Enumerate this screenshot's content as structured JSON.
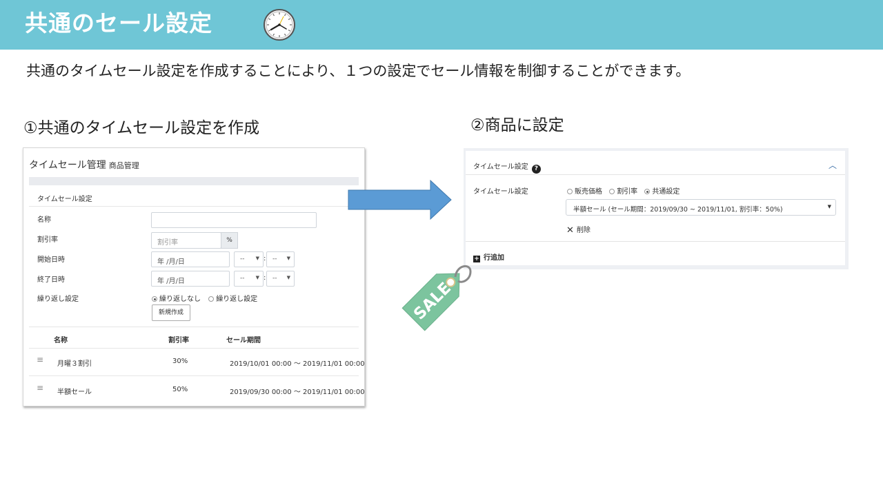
{
  "slide": {
    "title": "共通のセール設定",
    "lead": "共通のタイムセール設定を作成することにより、１つの設定でセール情報を制御することができます。",
    "step1": "①共通のタイムセール設定を作成",
    "step2": "②商品に設定"
  },
  "admin": {
    "title": "タイムセール管理",
    "subtitle": "商品管理",
    "section": "タイムセール設定",
    "name_label": "名称",
    "name_value": "",
    "rate_label": "割引率",
    "rate_placeholder": "割引率",
    "rate_unit": "%",
    "start_label": "開始日時",
    "end_label": "終了日時",
    "date_placeholder": "年 /月/日",
    "time_placeholder": "--",
    "repeat_label": "繰り返し設定",
    "repeat_options": [
      "繰り返しなし",
      "繰り返し設定"
    ],
    "repeat_selected": "繰り返しなし",
    "create_button": "新規作成",
    "columns": [
      "名称",
      "割引率",
      "セール期間"
    ],
    "rows": [
      {
        "name": "月曜３割引",
        "rate": "30%",
        "period": "2019/10/01 00:00 ～ 2019/11/01 00:00"
      },
      {
        "name": "半額セール",
        "rate": "50%",
        "period": "2019/09/30 00:00 ～ 2019/11/01 00:00"
      }
    ]
  },
  "product": {
    "header": "タイムセール設定",
    "field_label": "タイムセール設定",
    "options": [
      "販売価格",
      "割引率",
      "共通設定"
    ],
    "selected_option": "共通設定",
    "select_value": "半額セール (セール期間：2019/09/30 ~ 2019/11/01, 割引率：50%)",
    "delete_label": "削除",
    "add_row_label": "行追加"
  },
  "tag_text": "SALE",
  "colors": {
    "header_band": "#6fc6d6",
    "arrow": "#5b9bd5",
    "tag": "#7cc49e"
  },
  "icons": [
    "clock-icon",
    "help-icon",
    "chevron-up-icon",
    "close-icon",
    "plus-icon",
    "drag-handle-icon",
    "sale-tag-icon",
    "arrow-right-icon"
  ]
}
